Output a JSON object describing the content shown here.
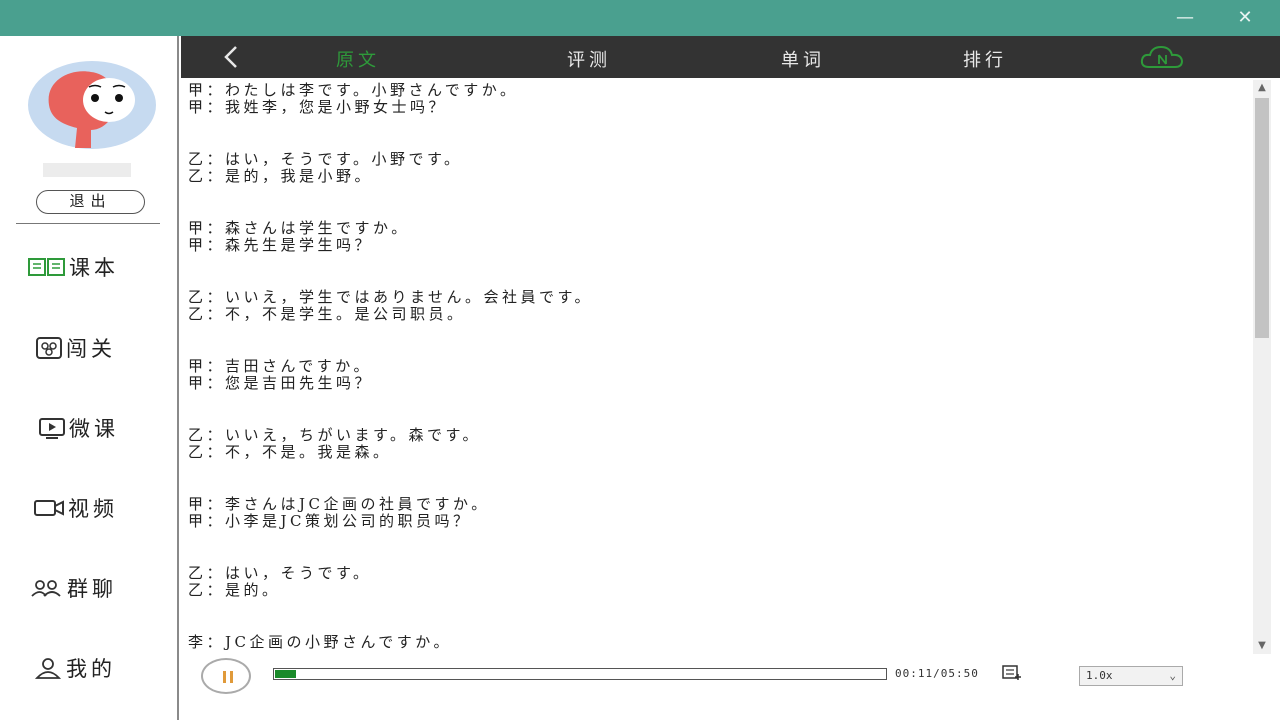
{
  "window": {
    "minimize": "—",
    "close": "✕"
  },
  "sidebar": {
    "logout_label": "退出",
    "items": [
      {
        "label": "课本",
        "icon": "book-icon"
      },
      {
        "label": "闯关",
        "icon": "level-icon"
      },
      {
        "label": "微课",
        "icon": "micro-lesson-icon"
      },
      {
        "label": "视频",
        "icon": "video-icon"
      },
      {
        "label": "群聊",
        "icon": "group-chat-icon"
      },
      {
        "label": "我的",
        "icon": "user-icon"
      }
    ]
  },
  "topnav": {
    "tabs": [
      {
        "label": "原文",
        "active": true
      },
      {
        "label": "评测",
        "active": false
      },
      {
        "label": "单词",
        "active": false
      },
      {
        "label": "排行",
        "active": false
      }
    ],
    "accent": "#2e9a3a"
  },
  "transcript": [
    [
      "甲：わたしは李です。小野さんですか。",
      "甲：我姓李，您是小野女士吗？"
    ],
    [
      "乙：はい，そうです。小野です。",
      "乙：是的，我是小野。"
    ],
    [
      "甲：森さんは学生ですか。",
      "甲：森先生是学生吗？"
    ],
    [
      "乙：いいえ，学生ではありません。会社員です。",
      "乙：不，不是学生。是公司职员。"
    ],
    [
      "甲：吉田さんですか。",
      "甲：您是吉田先生吗？"
    ],
    [
      "乙：いいえ，ちがいます。森です。",
      "乙：不，不是。我是森。"
    ],
    [
      "甲：李さんはJC企画の社員ですか。",
      "甲：小李是JC策划公司的职员吗？"
    ],
    [
      "乙：はい，そうです。",
      "乙：是的。"
    ],
    [
      "李：JC企画の小野さんですか。"
    ]
  ],
  "player": {
    "time": "00:11/05:50",
    "progress": 0.034,
    "speed": "1.0x"
  },
  "colors": {
    "titlebar": "#4aa08f",
    "topnav": "#333333",
    "progress": "#1a8a2a"
  }
}
